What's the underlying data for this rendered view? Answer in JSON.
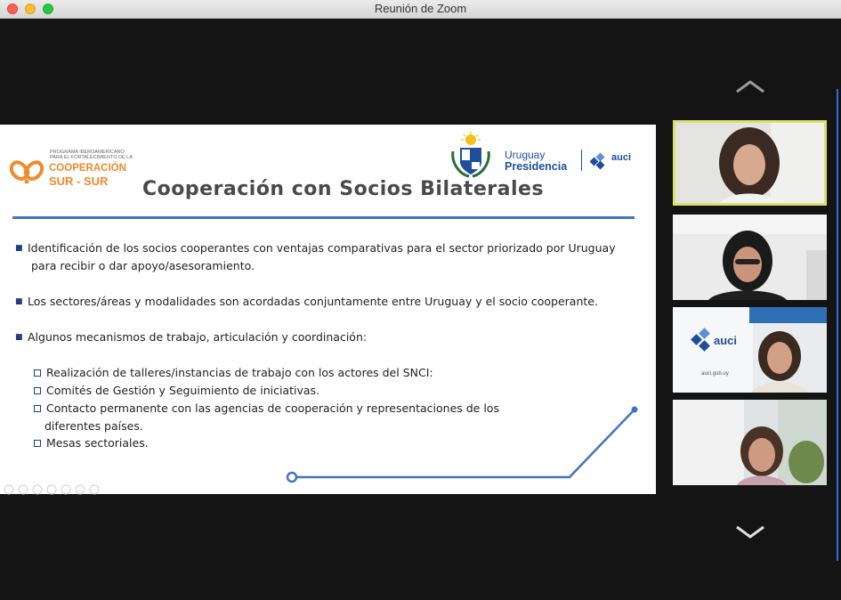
{
  "window": {
    "title": "Reunión de Zoom"
  },
  "slide": {
    "program_logo": {
      "line1": "PROGRAMA IBEROAMERICANO",
      "line2": "PARA EL FORTALECIMIENTO DE LA",
      "line3": "COOPERACIÓN",
      "line4": "SUR - SUR"
    },
    "uruguay_logo": {
      "line1": "Uruguay",
      "line2": "Presidencia"
    },
    "auci_logo": {
      "name": "auci"
    },
    "title": "Cooperación con Socios Bilaterales",
    "bullets": [
      {
        "line1": "Identificación de los socios cooperantes con ventajas comparativas para el sector priorizado por Uruguay",
        "line2": "para recibir o dar apoyo/asesoramiento."
      },
      {
        "line1": "Los sectores/áreas y modalidades son acordadas conjuntamente entre Uruguay y el socio cooperante."
      },
      {
        "line1": "Algunos mecanismos de trabajo, articulación y coordinación:"
      }
    ],
    "subitems": [
      {
        "line1": "Realización de talleres/instancias de trabajo con los actores del SNCI:"
      },
      {
        "line1": "Comités de Gestión y Seguimiento de iniciativas."
      },
      {
        "line1": "Contacto permanente con las agencias de cooperación y representaciones de los",
        "line2": "diferentes países."
      },
      {
        "line1": "Mesas sectoriales."
      }
    ],
    "accent_color": "#4472c4",
    "orange_color": "#f08a2c"
  },
  "participants": {
    "thumb3_logo": "auci",
    "thumb3_url": "auci.gub.uy"
  },
  "nav": {
    "up_icon": "chevron-up-icon",
    "down_icon": "chevron-down-icon"
  }
}
